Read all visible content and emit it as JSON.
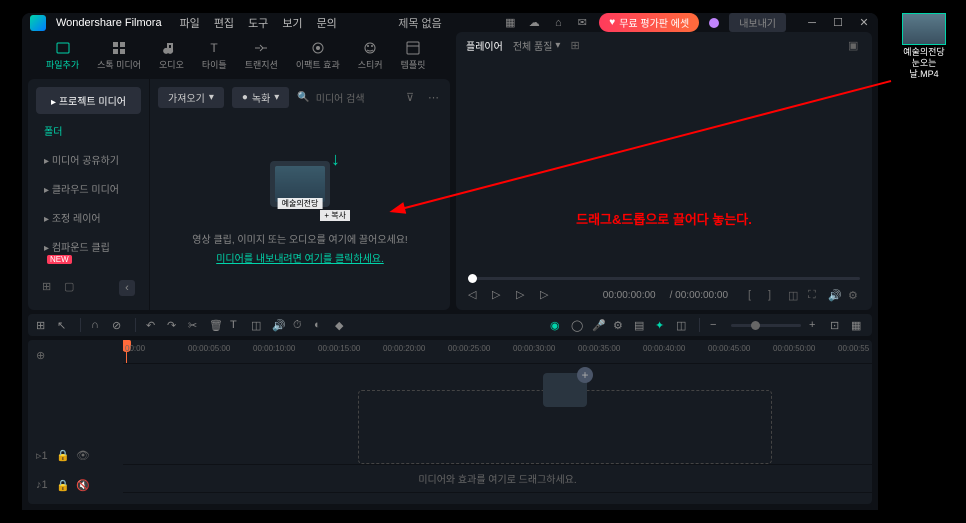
{
  "app": {
    "name": "Wondershare Filmora",
    "title": "제목 없음"
  },
  "menu": [
    "파일",
    "편집",
    "도구",
    "보기",
    "문의"
  ],
  "promo": "무료 평가판 에셋",
  "export": "내보내기",
  "tabs": [
    {
      "label": "파일추가",
      "active": true
    },
    {
      "label": "스톡 미디어"
    },
    {
      "label": "오디오"
    },
    {
      "label": "타이틀"
    },
    {
      "label": "트랜지션"
    },
    {
      "label": "이팩트 효과"
    },
    {
      "label": "스티커"
    },
    {
      "label": "템플릿"
    }
  ],
  "sidebar": {
    "project_btn": "프로젝트 미디어",
    "folder": "폴더",
    "items": [
      {
        "label": "미디어 공유하기"
      },
      {
        "label": "클라우드 미디어"
      },
      {
        "label": "조정 레이어"
      },
      {
        "label": "컴파운드 클립",
        "new": true
      }
    ]
  },
  "media_toolbar": {
    "import": "가져오기",
    "record": "녹화",
    "search_placeholder": "미디어 검색"
  },
  "drop_zone": {
    "thumb_label": "예술의전당",
    "copy_label": "+ 복사",
    "text": "영상 클립, 이미지 또는 오디오를 여기에 끌어오세요!",
    "link": "미디어를 내보내려면 여기를 클릭하세요."
  },
  "preview": {
    "player_tab": "플레이어",
    "quality": "전체 품질",
    "time_current": "00:00:00:00",
    "time_total": "00:00:00:00"
  },
  "timeline": {
    "ruler": [
      "00:00",
      "00:00:05:00",
      "00:00:10:00",
      "00:00:15:00",
      "00:00:20:00",
      "00:00:25:00",
      "00:00:30:00",
      "00:00:35:00",
      "00:00:40:00",
      "00:00:45:00",
      "00:00:50:00",
      "00:00:55"
    ],
    "drop_text": "미디어와 효과를 여기로 드래그하세요.",
    "video_track": "1",
    "audio_track": "1"
  },
  "annotation": "드래그&드롭으로 끌어다 놓는다.",
  "external_file": "예술의전당\n눈오는\n날.MP4"
}
